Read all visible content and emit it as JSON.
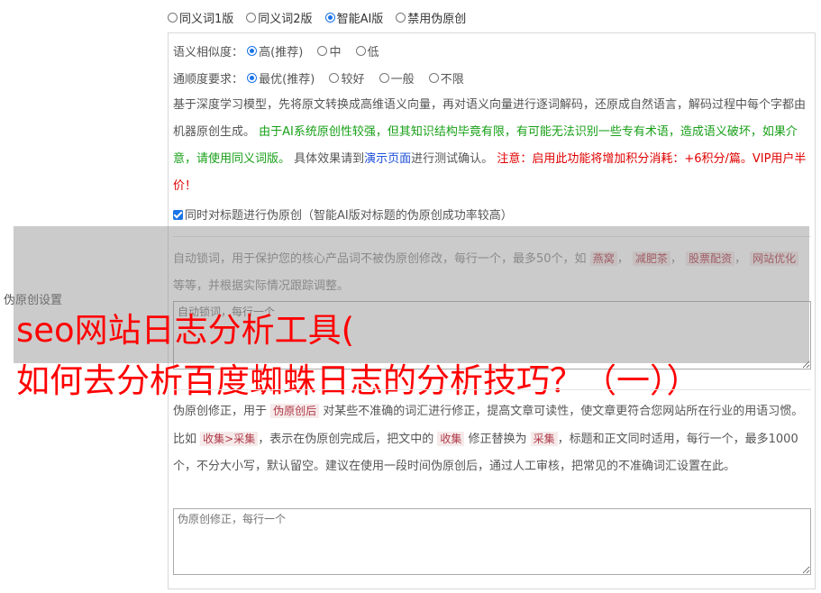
{
  "mode_options": [
    {
      "label": "同义词1版",
      "selected": false
    },
    {
      "label": "同义词2版",
      "selected": false
    },
    {
      "label": "智能AI版",
      "selected": true
    },
    {
      "label": "禁用伪原创",
      "selected": false
    }
  ],
  "similarity": {
    "label": "语义相似度：",
    "options": [
      {
        "label": "高(推荐)",
        "selected": true
      },
      {
        "label": "中",
        "selected": false
      },
      {
        "label": "低",
        "selected": false
      }
    ]
  },
  "fluency": {
    "label": "通顺度要求：",
    "options": [
      {
        "label": "最优(推荐)",
        "selected": true
      },
      {
        "label": "较好",
        "selected": false
      },
      {
        "label": "一般",
        "selected": false
      },
      {
        "label": "不限",
        "selected": false
      }
    ]
  },
  "description": {
    "part1": "基于深度学习模型，先将原文转换成高维语义向量，再对语义向量进行逐词解码，还原成自然语言，解码过程中每个字都由机器原创生成。 ",
    "green1": "由于AI系统原创性较强，但其知识结构毕竟有限，有可能无法识别一些专有术语，造成语义破坏，如果介意，请使用同义词版。",
    "part2": " 具体效果请到",
    "link": "演示页面",
    "part3": "进行测试确认。 ",
    "red1": "注意：启用此功能将增加积分消耗：+6积分/篇。VIP用户半价！"
  },
  "title_checkbox": {
    "label": "同时对标题进行伪原创（智能AI版对标题的伪原创成功率较高）",
    "checked": true
  },
  "lock_words": {
    "text1": "自动锁词，用于保护您的核心产品词不被伪原创修改，每行一个，最多50个，如 ",
    "tags": [
      "燕窝",
      "减肥茶",
      "股票配资",
      "网站优化"
    ],
    "text2": " 等等，并根据实际情况跟踪调整。",
    "placeholder": "自动锁词，每行一个"
  },
  "side_label": "伪原创设置",
  "overlay_title": {
    "line1": "seo网站日志分析工具(",
    "line2": "如何去分析百度蜘蛛日志的分析技巧？（一））"
  },
  "correction": {
    "text1": "伪原创修正，用于 ",
    "tag1": "伪原创后",
    "text2": " 对某些不准确的词汇进行修正，提高文章可读性，使文章更符合您网站所在行业的用语习惯。比如 ",
    "tag2": "收集>采集",
    "text3": "，表示在伪原创完成后，把文中的 ",
    "tag3": "收集",
    "text4": " 修正替换为 ",
    "tag4": "采集",
    "text5": "，标题和正文同时适用，每行一个，最多1000个，不分大小写，默认留空。建议在使用一段时间伪原创后，通过人工审核，把常见的不准确词汇设置在此。",
    "placeholder": "伪原创修正，每行一个"
  },
  "colors": {
    "accent": "#1a73e8",
    "green": "#18a018",
    "red": "#e00000",
    "link": "#1d4ed8",
    "overlay_text": "#ff0000"
  }
}
